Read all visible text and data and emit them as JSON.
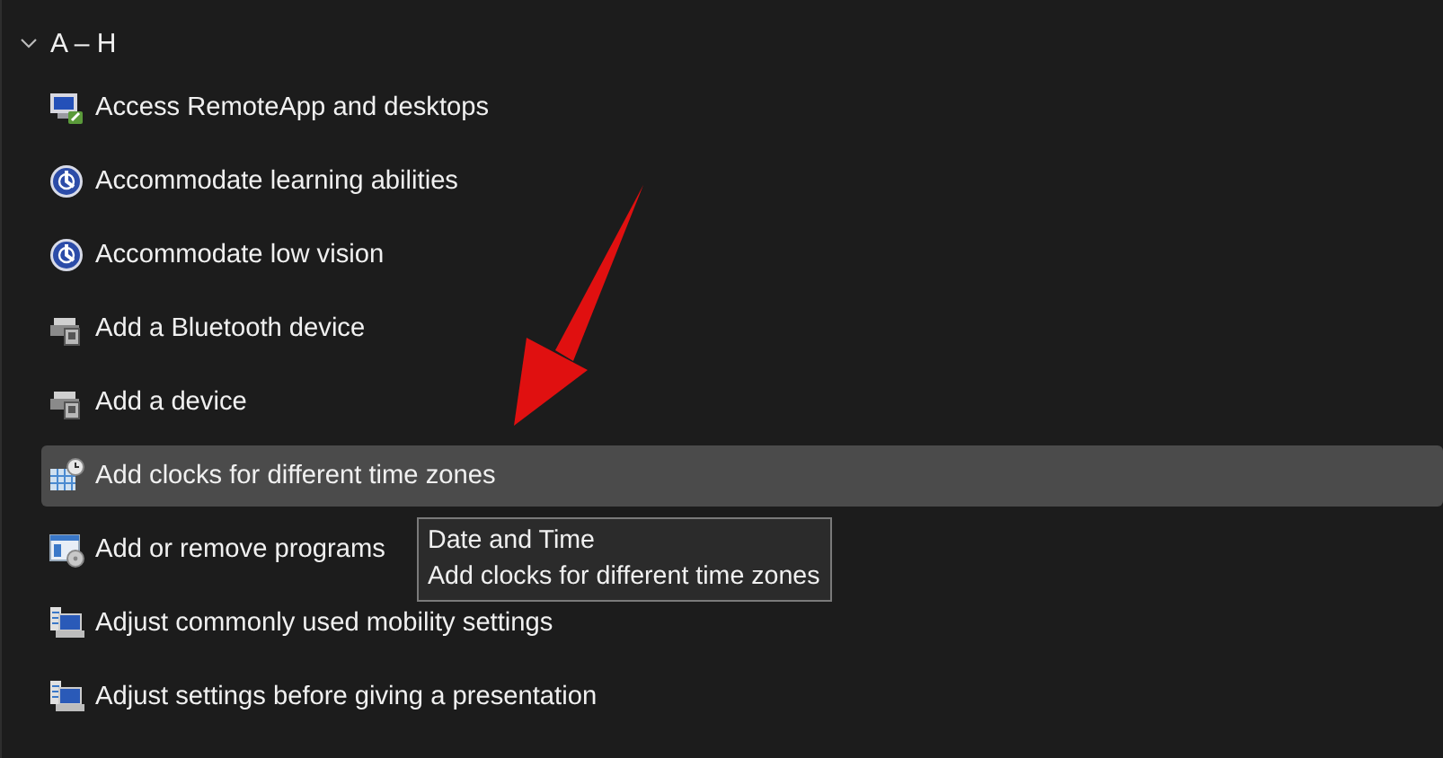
{
  "group": {
    "label": "A – H",
    "expanded": true
  },
  "items": [
    {
      "label": "Access RemoteApp and desktops",
      "kind": "remote",
      "selected": false
    },
    {
      "label": "Accommodate learning abilities",
      "kind": "ease",
      "selected": false
    },
    {
      "label": "Accommodate low vision",
      "kind": "ease",
      "selected": false
    },
    {
      "label": "Add a Bluetooth device",
      "kind": "device",
      "selected": false
    },
    {
      "label": "Add a device",
      "kind": "device",
      "selected": false
    },
    {
      "label": "Add clocks for different time zones",
      "kind": "clock",
      "selected": true
    },
    {
      "label": "Add or remove programs",
      "kind": "programs",
      "selected": false
    },
    {
      "label": "Adjust commonly used mobility settings",
      "kind": "mobility",
      "selected": false
    },
    {
      "label": "Adjust settings before giving a presentation",
      "kind": "mobility",
      "selected": false
    }
  ],
  "tooltip": {
    "title": "Date and Time",
    "text": "Add clocks for different time zones"
  }
}
